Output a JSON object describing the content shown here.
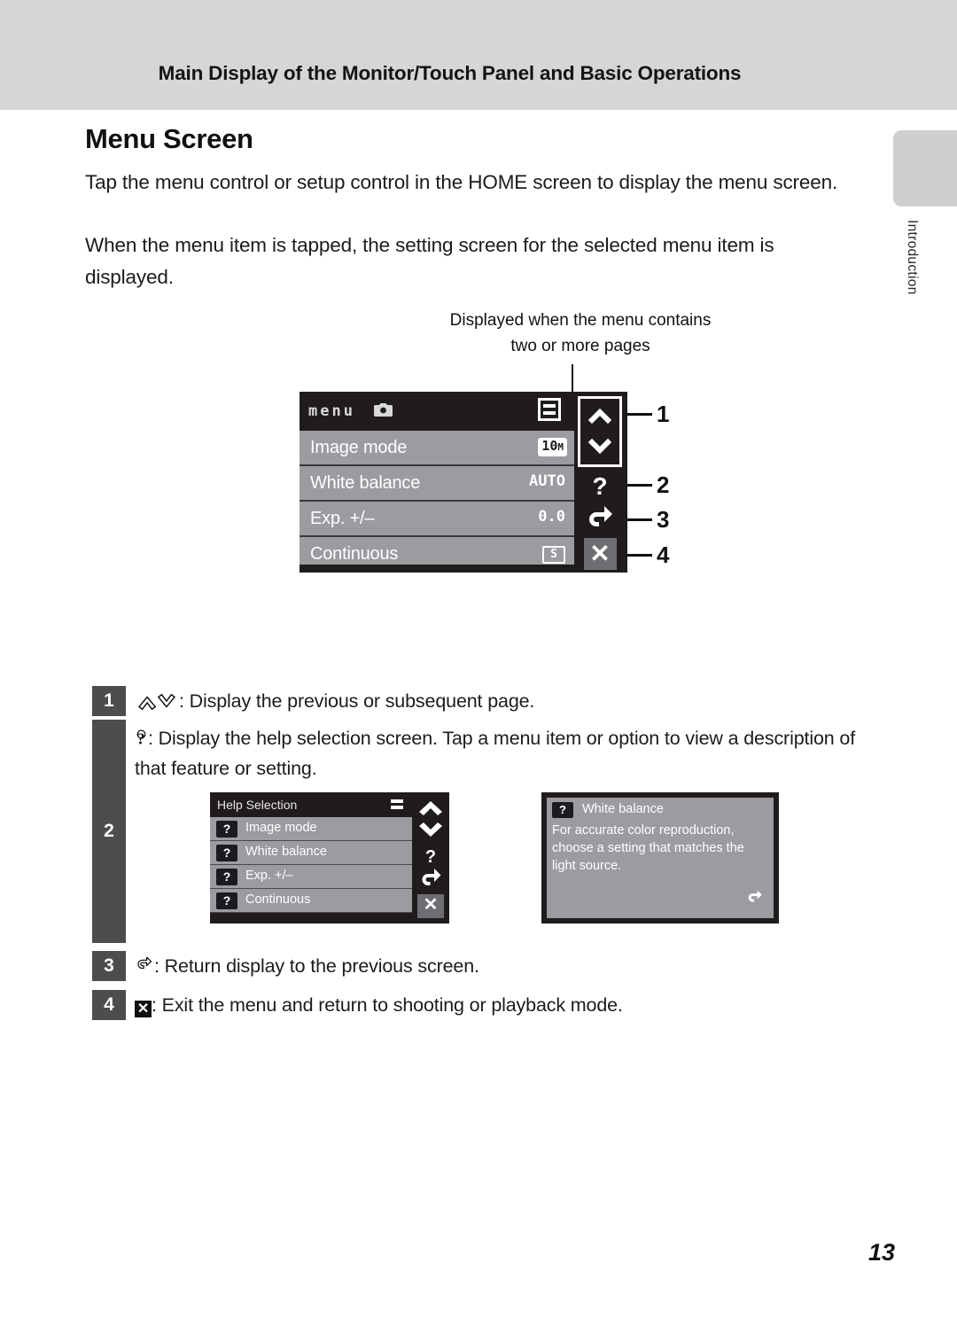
{
  "header": {
    "running_title": "Main Display of the Monitor/Touch Panel and Basic Operations"
  },
  "side_tab": {
    "label": "Introduction"
  },
  "section": {
    "title": "Menu Screen",
    "paragraph_1": "Tap the menu control or setup control in the HOME screen to display the menu screen.",
    "paragraph_2": "When the menu item is tapped, the setting screen for the selected menu item is displayed."
  },
  "figure": {
    "callout": "Displayed when the menu contains two or more pages",
    "menu_screen": {
      "title_word": "menu",
      "title_icon": "camera-icon",
      "pager_icon": "two-pages-icon",
      "rows": [
        {
          "label": "Image mode",
          "value": "10",
          "value_suffix": "M",
          "value_style": "badge-white"
        },
        {
          "label": "White balance",
          "value": "AUTO",
          "value_style": "plain"
        },
        {
          "label": "Exp. +/–",
          "value": "0.0",
          "value_style": "plain"
        },
        {
          "label": "Continuous",
          "value": "S",
          "value_style": "badge-outline"
        }
      ],
      "controls": [
        {
          "icon": "chevron-up-icon",
          "glyph": "▲"
        },
        {
          "icon": "chevron-down-icon",
          "glyph": "▼"
        },
        {
          "icon": "help-question-icon",
          "glyph": "?"
        },
        {
          "icon": "return-arrow-icon",
          "glyph": "↶"
        },
        {
          "icon": "close-x-icon",
          "glyph": "✕"
        }
      ]
    },
    "callouts": [
      {
        "number": "1"
      },
      {
        "number": "2"
      },
      {
        "number": "3"
      },
      {
        "number": "4"
      }
    ]
  },
  "legend": [
    {
      "number": "1",
      "glyph": "▲▼",
      "text": ": Display the previous or subsequent page."
    },
    {
      "number": "2",
      "glyph": "?",
      "text": ": Display the help selection screen. Tap a menu item or option to view a description of that feature or setting."
    },
    {
      "number": "3",
      "glyph": "↶",
      "text": ": Return display to the previous screen."
    },
    {
      "number": "4",
      "glyph": "✕",
      "text": ": Exit the menu and return to shooting or playback mode."
    }
  ],
  "help_selection_screen": {
    "title": "Help Selection",
    "pager_icon": "two-pages-icon",
    "rows": [
      {
        "icon": "help-question-icon",
        "label": "Image mode"
      },
      {
        "icon": "help-question-icon",
        "label": "White balance"
      },
      {
        "icon": "help-question-icon",
        "label": "Exp. +/–"
      },
      {
        "icon": "help-question-icon",
        "label": "Continuous"
      }
    ],
    "controls": [
      {
        "icon": "chevron-up-icon",
        "glyph": "▲"
      },
      {
        "icon": "chevron-down-icon",
        "glyph": "▼"
      },
      {
        "icon": "help-question-icon",
        "glyph": "?"
      },
      {
        "icon": "return-arrow-icon",
        "glyph": "↶"
      },
      {
        "icon": "close-x-icon",
        "glyph": "✕"
      }
    ]
  },
  "white_balance_help_screen": {
    "title": "White balance",
    "icon": "help-question-icon",
    "body": "For accurate color reproduction, choose a setting that matches the light source.",
    "back_icon": "return-arrow-icon"
  },
  "footer": {
    "page_number": "13"
  },
  "colors": {
    "header_band": "#d6d6d6",
    "side_tab": "#cfcfcf",
    "screen_bezel": "#201c1e",
    "menu_row": "#9b9ba0",
    "number_badge": "#4d4d4d",
    "text": "#1c1c1c"
  }
}
